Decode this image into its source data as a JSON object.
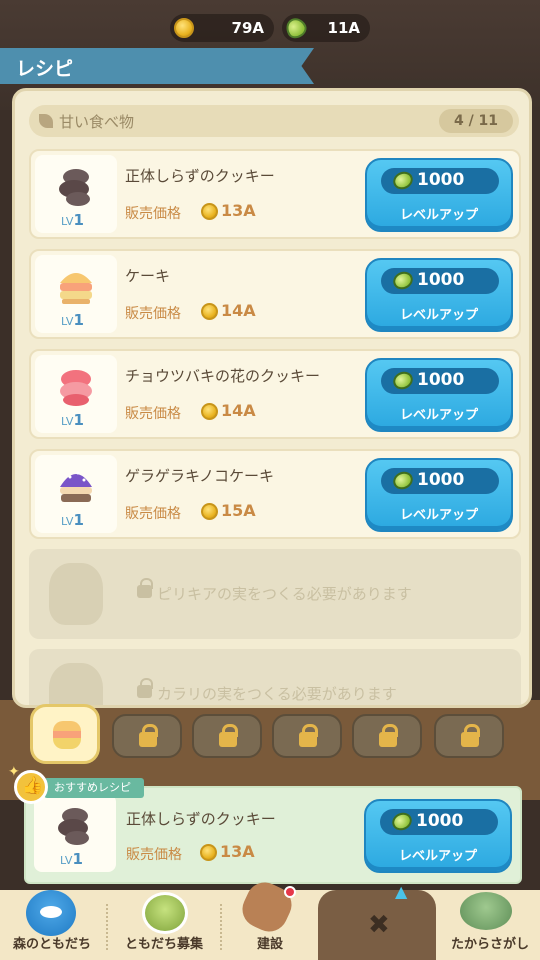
{
  "currency": {
    "coins": "79A",
    "leaves": "11A"
  },
  "title": "レシピ",
  "category": {
    "label": "甘い食べ物",
    "count": "4 / 11"
  },
  "recipes": [
    {
      "name": "正体しらずのクッキー",
      "level": "1",
      "price_label": "販売価格",
      "price": "13A",
      "cost": "1000",
      "button": "レベルアップ",
      "color": "#6b5a5a"
    },
    {
      "name": "ケーキ",
      "level": "1",
      "price_label": "販売価格",
      "price": "14A",
      "cost": "1000",
      "button": "レベルアップ",
      "color": "#f4b27e"
    },
    {
      "name": "チョウツバキの花のクッキー",
      "level": "1",
      "price_label": "販売価格",
      "price": "14A",
      "cost": "1000",
      "button": "レベルアップ",
      "color": "#f2727e"
    },
    {
      "name": "ゲラゲラキノコケーキ",
      "level": "1",
      "price_label": "販売価格",
      "price": "15A",
      "cost": "1000",
      "button": "レベルアップ",
      "color": "#7a55c8"
    }
  ],
  "locked": [
    {
      "text": "ピリキアの実をつくる必要があります"
    },
    {
      "text": "カラリの実をつくる必要があります"
    }
  ],
  "lv_prefix": "LV",
  "recommended": {
    "ribbon": "おすすめレシピ",
    "name": "正体しらずのクッキー",
    "level": "1",
    "price_label": "販売価格",
    "price": "13A",
    "cost": "1000",
    "button": "レベルアップ"
  },
  "nav": {
    "friends": "森のともだち",
    "recruit": "ともだち募集",
    "build": "建設",
    "close": "✖",
    "treasure": "たからさがし"
  },
  "colors": {
    "accent": "#2ba8e0",
    "banner": "#4e8fae",
    "panel": "#f3ecd2"
  }
}
